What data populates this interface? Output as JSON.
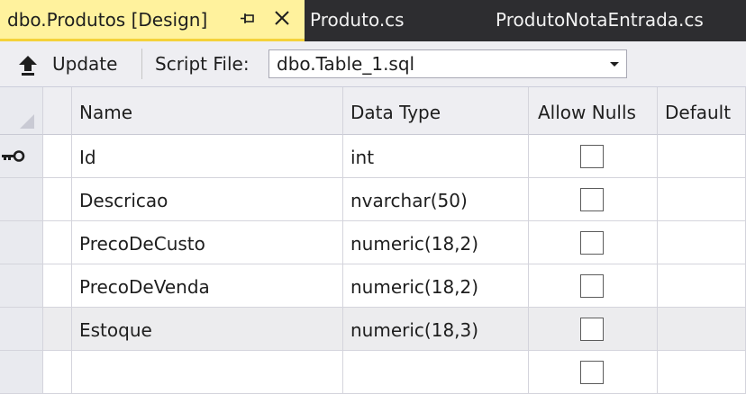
{
  "tabs": {
    "active": "dbo.Produtos [Design]",
    "inactive": [
      "Produto.cs",
      "ProdutoNotaEntrada.cs"
    ]
  },
  "toolbar": {
    "update_label": "Update",
    "script_file_label": "Script File:",
    "script_file_value": "dbo.Table_1.sql"
  },
  "grid": {
    "headers": {
      "name": "Name",
      "type": "Data Type",
      "nulls": "Allow Nulls",
      "default": "Default"
    },
    "rows": [
      {
        "name": "Id",
        "type": "int",
        "allow_nulls": false,
        "primary_key": true
      },
      {
        "name": "Descricao",
        "type": "nvarchar(50)",
        "allow_nulls": false
      },
      {
        "name": "PrecoDeCusto",
        "type": "numeric(18,2)",
        "allow_nulls": false
      },
      {
        "name": "PrecoDeVenda",
        "type": "numeric(18,2)",
        "allow_nulls": false
      },
      {
        "name": "Estoque",
        "type": "numeric(18,3)",
        "allow_nulls": false
      },
      {
        "name": "",
        "type": "",
        "allow_nulls": false
      }
    ]
  },
  "colors": {
    "active_tab": "#fff29d",
    "tabstrip": "#2d2d30",
    "toolbar": "#eeeef2"
  },
  "icons": {
    "pin": "pin-icon",
    "close": "close-icon",
    "update": "arrow-up-icon",
    "key": "key-icon",
    "dropdown": "chevron-down-icon"
  }
}
